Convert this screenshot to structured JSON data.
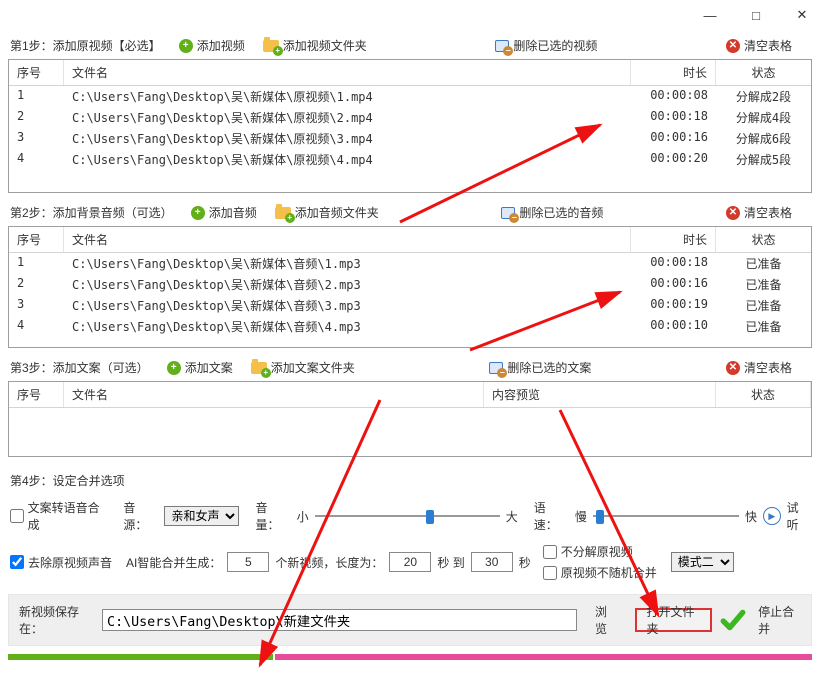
{
  "titlebar": {
    "min": "—",
    "max": "□",
    "close": "✕"
  },
  "step1": {
    "label": "第1步：添加原视频【必选】",
    "add": "添加视频",
    "folder": "添加视频文件夹",
    "delete": "删除已选的视频",
    "clear": "清空表格",
    "cols": {
      "idx": "序号",
      "name": "文件名",
      "dur": "时长",
      "status": "状态"
    },
    "rows": [
      {
        "idx": "1",
        "name": "C:\\Users\\Fang\\Desktop\\吴\\新媒体\\原视频\\1.mp4",
        "dur": "00:00:08",
        "status": "分解成2段"
      },
      {
        "idx": "2",
        "name": "C:\\Users\\Fang\\Desktop\\吴\\新媒体\\原视频\\2.mp4",
        "dur": "00:00:18",
        "status": "分解成4段"
      },
      {
        "idx": "3",
        "name": "C:\\Users\\Fang\\Desktop\\吴\\新媒体\\原视频\\3.mp4",
        "dur": "00:00:16",
        "status": "分解成6段"
      },
      {
        "idx": "4",
        "name": "C:\\Users\\Fang\\Desktop\\吴\\新媒体\\原视频\\4.mp4",
        "dur": "00:00:20",
        "status": "分解成5段"
      }
    ]
  },
  "step2": {
    "label": "第2步：添加背景音频（可选）",
    "add": "添加音频",
    "folder": "添加音频文件夹",
    "delete": "删除已选的音频",
    "clear": "清空表格",
    "cols": {
      "idx": "序号",
      "name": "文件名",
      "dur": "时长",
      "status": "状态"
    },
    "rows": [
      {
        "idx": "1",
        "name": "C:\\Users\\Fang\\Desktop\\吴\\新媒体\\音频\\1.mp3",
        "dur": "00:00:18",
        "status": "已准备"
      },
      {
        "idx": "2",
        "name": "C:\\Users\\Fang\\Desktop\\吴\\新媒体\\音频\\2.mp3",
        "dur": "00:00:16",
        "status": "已准备"
      },
      {
        "idx": "3",
        "name": "C:\\Users\\Fang\\Desktop\\吴\\新媒体\\音频\\3.mp3",
        "dur": "00:00:19",
        "status": "已准备"
      },
      {
        "idx": "4",
        "name": "C:\\Users\\Fang\\Desktop\\吴\\新媒体\\音频\\4.mp3",
        "dur": "00:00:10",
        "status": "已准备"
      }
    ]
  },
  "step3": {
    "label": "第3步：添加文案（可选）",
    "add": "添加文案",
    "folder": "添加文案文件夹",
    "delete": "删除已选的文案",
    "clear": "清空表格",
    "cols": {
      "idx": "序号",
      "name": "文件名",
      "preview": "内容预览",
      "status": "状态"
    }
  },
  "step4": {
    "label": "第4步：设定合并选项",
    "tts": "文案转语音合成",
    "voice_label": "音源：",
    "voice_value": "亲和女声",
    "vol_label": "音量：",
    "vol_small": "小",
    "vol_big": "大",
    "speed_label": "语速：",
    "speed_slow": "慢",
    "speed_fast": "快",
    "preview": "试听",
    "remove_orig_audio": "去除原视频声音",
    "ai_gen_label": "AI智能合并生成：",
    "ai_count": "5",
    "ai_unit": "个新视频，长度为：",
    "len_from": "20",
    "sec_to": "秒 到",
    "len_to": "30",
    "sec": "秒",
    "no_split": "不分解原视频",
    "no_random": "原视频不随机合并",
    "mode_value": "模式二"
  },
  "save": {
    "label": "新视频保存在：",
    "path": "C:\\Users\\Fang\\Desktop\\新建文件夹",
    "browse": "浏览",
    "open": "打开文件夹",
    "stop": "停止合并"
  }
}
